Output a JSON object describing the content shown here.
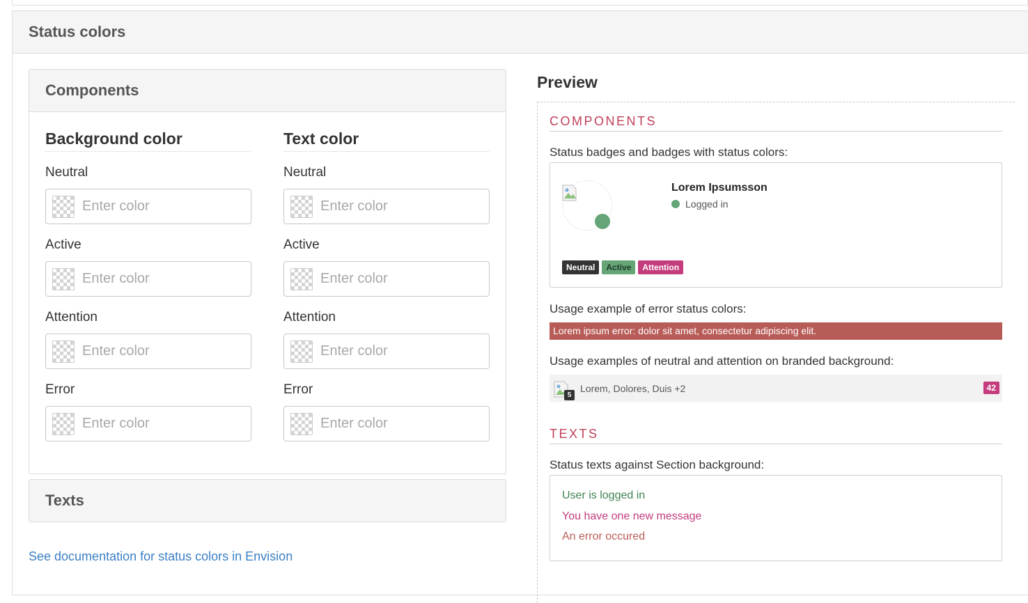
{
  "section": {
    "title": "Status colors"
  },
  "components_panel": {
    "title": "Components",
    "background": {
      "title": "Background color",
      "fields": [
        {
          "label": "Neutral",
          "placeholder": "Enter color"
        },
        {
          "label": "Active",
          "placeholder": "Enter color"
        },
        {
          "label": "Attention",
          "placeholder": "Enter color"
        },
        {
          "label": "Error",
          "placeholder": "Enter color"
        }
      ]
    },
    "text": {
      "title": "Text color",
      "fields": [
        {
          "label": "Neutral",
          "placeholder": "Enter color"
        },
        {
          "label": "Active",
          "placeholder": "Enter color"
        },
        {
          "label": "Attention",
          "placeholder": "Enter color"
        },
        {
          "label": "Error",
          "placeholder": "Enter color"
        }
      ]
    }
  },
  "texts_panel": {
    "title": "Texts"
  },
  "doc_link": "See documentation for status colors in Envision",
  "preview": {
    "title": "Preview",
    "components_heading": "COMPONENTS",
    "badges_label": "Status badges and badges with status colors:",
    "person": {
      "name": "Lorem Ipsumsson",
      "status": "Logged in"
    },
    "badges": [
      {
        "label": "Neutral",
        "color": "#333333"
      },
      {
        "label": "Active",
        "color": "#65a577"
      },
      {
        "label": "Attention",
        "color": "#c43c7d"
      }
    ],
    "error_label": "Usage example of error status colors:",
    "error_text": "Lorem ipsum error: dolor sit amet, consectetur adipiscing elit.",
    "branded_label": "Usage examples of neutral and attention on branded background:",
    "branded": {
      "count": "5",
      "names": "Lorem, Dolores, Duis +2",
      "badge": "42"
    },
    "texts_heading": "TEXTS",
    "texts_label": "Status texts against Section background:",
    "status_texts": [
      {
        "text": "User is logged in",
        "color": "#3f8452"
      },
      {
        "text": "You have one new message",
        "color": "#c43c7d"
      },
      {
        "text": "An error occured",
        "color": "#b85c58"
      }
    ]
  }
}
